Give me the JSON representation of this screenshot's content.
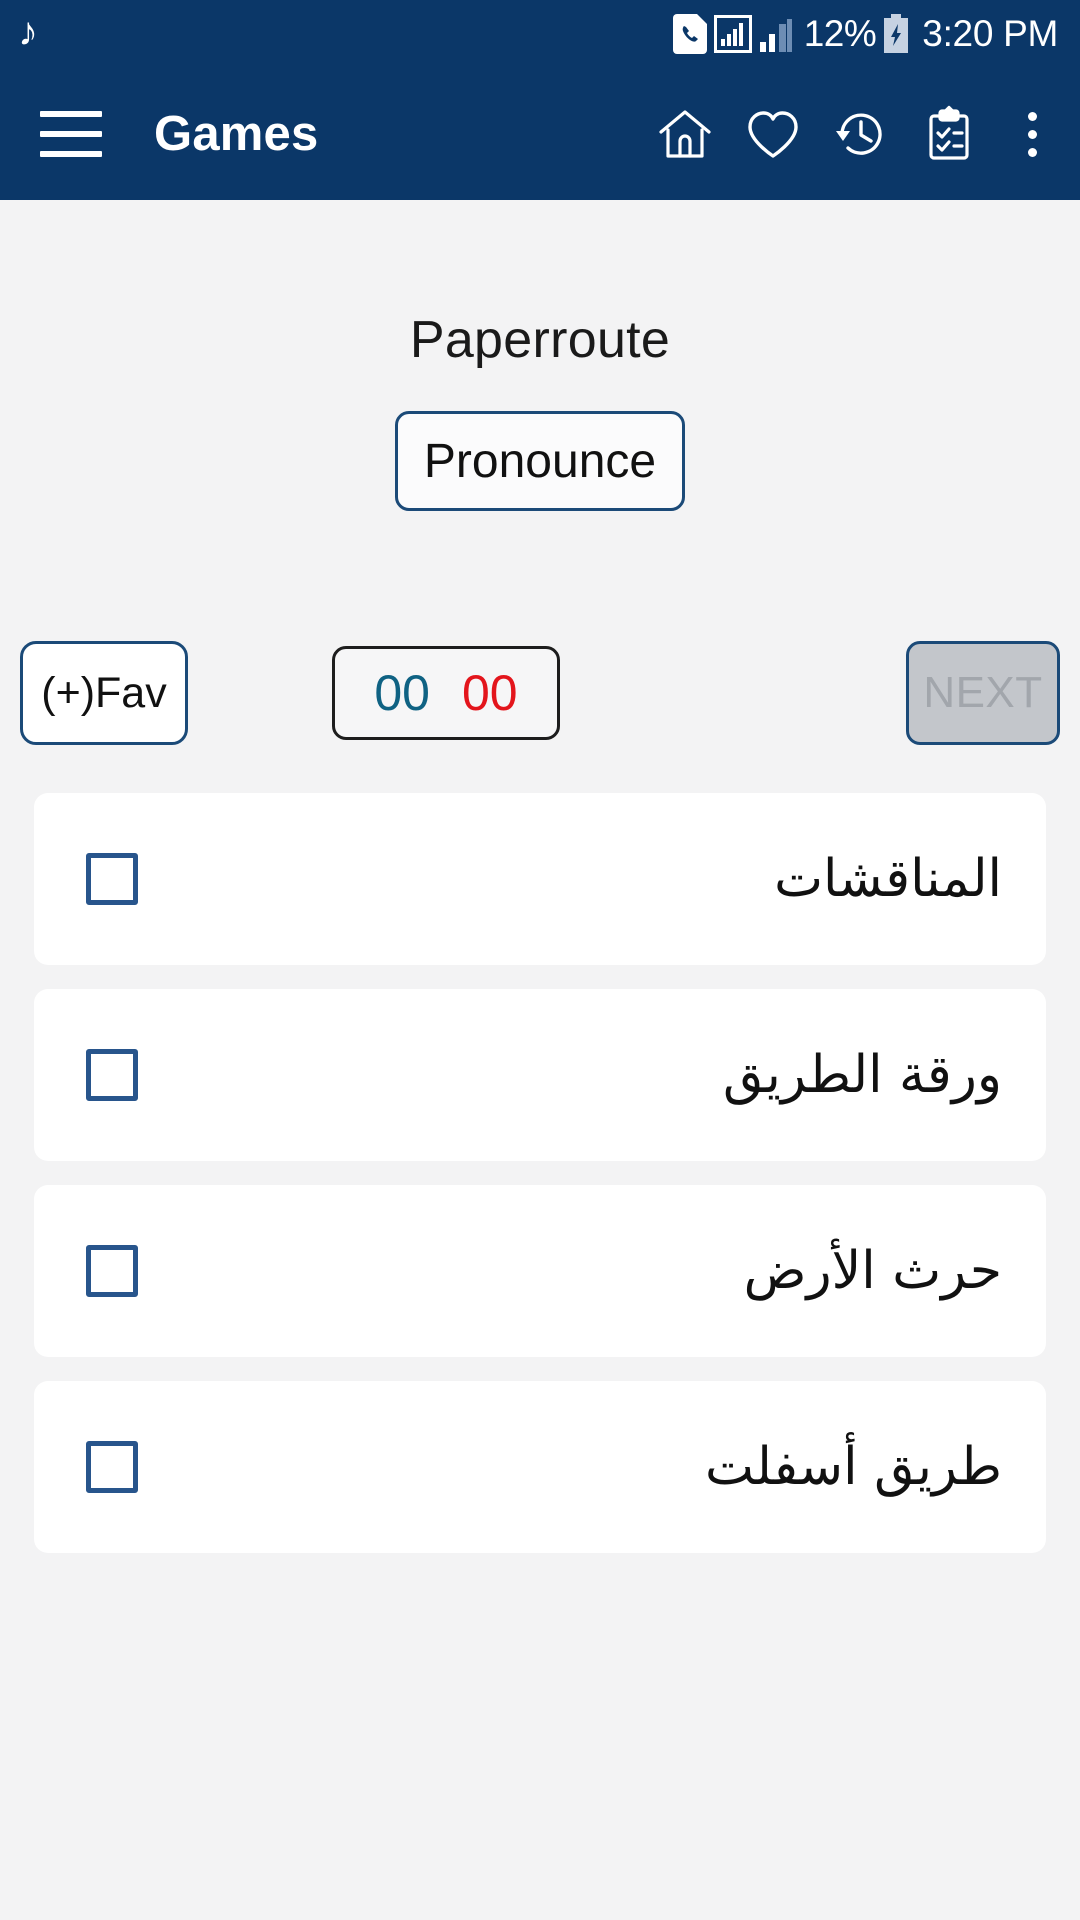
{
  "status_bar": {
    "music_icon": "music-note-icon",
    "voicemail_icon": "phone-sim-icon",
    "signal_icon": "signal-bars-boxed-icon",
    "signal2_icon": "signal-bars-icon",
    "battery_percent": "12%",
    "battery_icon": "battery-charging-icon",
    "clock": "3:20 PM"
  },
  "app_bar": {
    "menu_icon": "hamburger-menu-icon",
    "title": "Games",
    "actions": [
      {
        "name": "home-icon"
      },
      {
        "name": "heart-icon"
      },
      {
        "name": "history-icon"
      },
      {
        "name": "clipboard-checklist-icon"
      }
    ],
    "overflow_icon": "overflow-menu-icon"
  },
  "main": {
    "word": "Paperroute",
    "pronounce_label": "Pronounce",
    "fav_label": "(+)Fav",
    "next_label": "NEXT",
    "score": {
      "correct": "00",
      "wrong": "00",
      "correct_color": "#0f6283",
      "wrong_color": "#e3151c"
    },
    "options": [
      {
        "label": "المناقشات",
        "checked": false
      },
      {
        "label": "ورقة الطريق",
        "checked": false
      },
      {
        "label": "حرث الأرض",
        "checked": false
      },
      {
        "label": "طريق أسفلت",
        "checked": false
      }
    ]
  },
  "colors": {
    "app_bar": "#0b3768",
    "page_background": "#f3f3f4",
    "card": "#ffffff",
    "outline": "#1b4a78",
    "checkbox": "#28558c",
    "next_disabled_fill": "#c3c6cb",
    "next_disabled_text": "#a2a6ac"
  }
}
